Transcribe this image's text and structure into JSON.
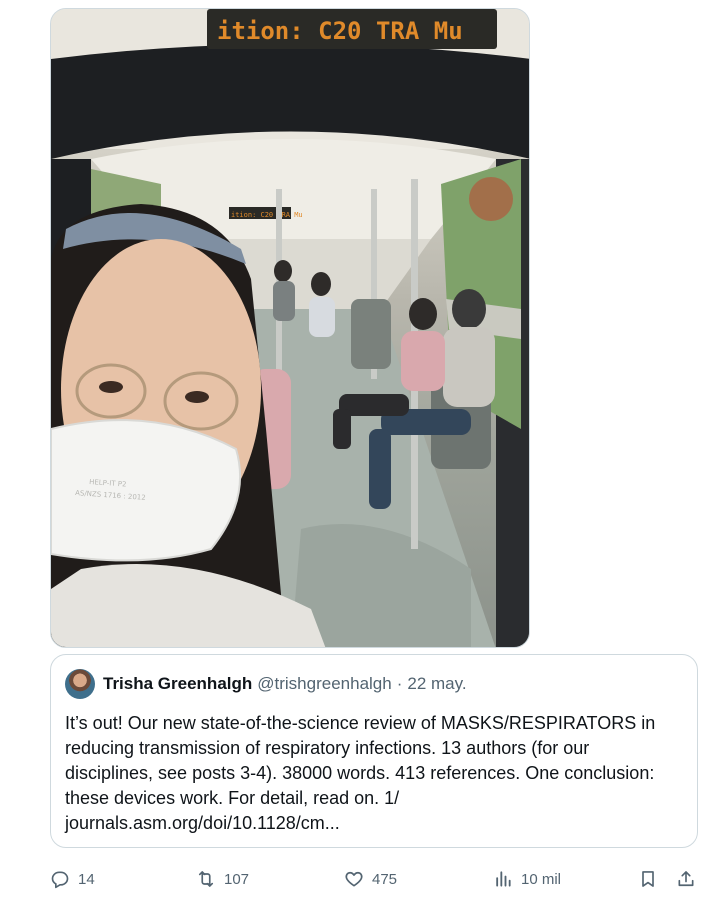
{
  "photo": {
    "sign_text": "ition: C20 TRA Mu",
    "inner_sign_text": "ition: C20 TRA Mu",
    "mask_text_1": "HELP-IT P2",
    "mask_text_2": "AS/NZS 1716 : 2012"
  },
  "quoted_tweet": {
    "author_name": "Trisha Greenhalgh",
    "author_handle": "@trishgreenhalgh",
    "separator": "·",
    "date": "22 may.",
    "text": "It’s out! Our new state-of-the-science review of MASKS/RESPIRATORS in\nreducing transmission of respiratory infections. 13 authors (for our\ndisciplines, see posts 3-4). 38000 words. 413 references. One conclusion:\nthese devices work. For detail, read on. 1/\njournals.asm.org/doi/10.1128/cm..."
  },
  "actions": {
    "reply_count": "14",
    "retweet_count": "107",
    "like_count": "475",
    "views_count": "10 mil"
  }
}
